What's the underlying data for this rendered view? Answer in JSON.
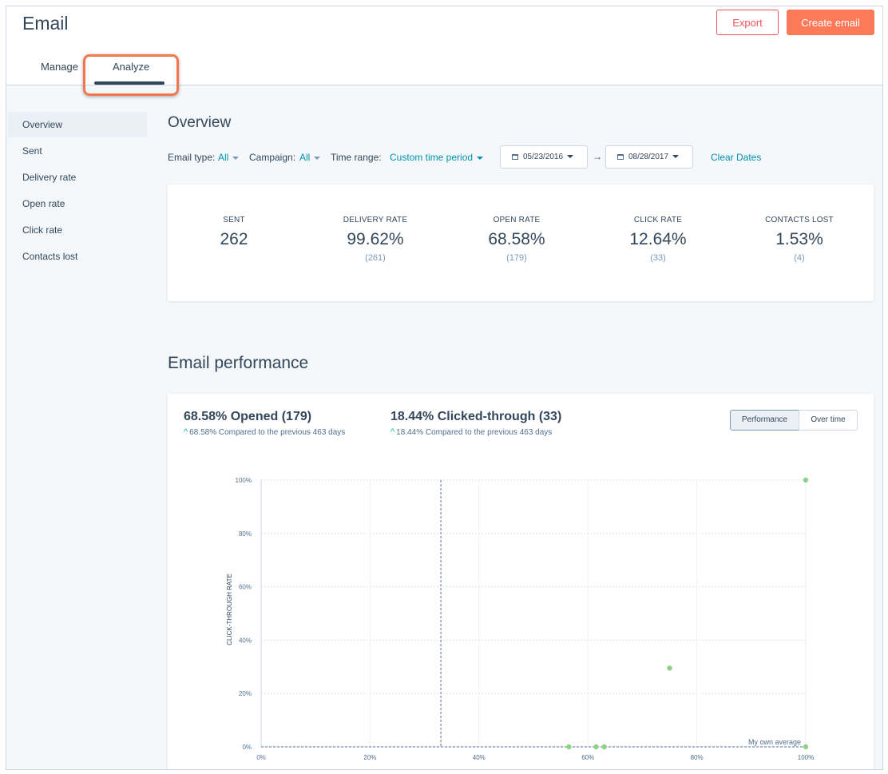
{
  "header": {
    "title": "Email",
    "export_label": "Export",
    "create_label": "Create email",
    "tabs": [
      {
        "label": "Manage"
      },
      {
        "label": "Analyze"
      }
    ]
  },
  "sidebar": {
    "items": [
      {
        "label": "Overview"
      },
      {
        "label": "Sent"
      },
      {
        "label": "Delivery rate"
      },
      {
        "label": "Open rate"
      },
      {
        "label": "Click rate"
      },
      {
        "label": "Contacts lost"
      }
    ]
  },
  "overview": {
    "title": "Overview",
    "filters": {
      "email_type_label": "Email type:",
      "email_type_value": "All",
      "campaign_label": "Campaign:",
      "campaign_value": "All",
      "time_range_label": "Time range:",
      "time_range_value": "Custom time period",
      "start_date": "05/23/2016",
      "end_date": "08/28/2017",
      "arrow": "→",
      "clear_label": "Clear Dates"
    },
    "stats": [
      {
        "label": "SENT",
        "value": "262",
        "sub": ""
      },
      {
        "label": "DELIVERY RATE",
        "value": "99.62%",
        "sub": "(261)"
      },
      {
        "label": "OPEN RATE",
        "value": "68.58%",
        "sub": "(179)"
      },
      {
        "label": "CLICK RATE",
        "value": "12.64%",
        "sub": "(33)"
      },
      {
        "label": "CONTACTS LOST",
        "value": "1.53%",
        "sub": "(4)"
      }
    ]
  },
  "performance": {
    "title": "Email performance",
    "opened_headline": "68.58% Opened (179)",
    "opened_compare": "68.58% Compared to the previous 463 days",
    "clicked_headline": "18.44% Clicked-through (33)",
    "clicked_compare": "18.44% Compared to the previous 463 days",
    "toggle_performance": "Performance",
    "toggle_over_time": "Over time",
    "up_arrow": "^"
  },
  "colors": {
    "accent": "#ff7a59",
    "teal_link": "#0091ae",
    "point": "#8fd08a",
    "text": "#33475b"
  },
  "chart_data": {
    "type": "scatter",
    "ylabel": "CLICK-THROUGH RATE",
    "xlabel": "",
    "x_ticks": [
      "0%",
      "20%",
      "40%",
      "60%",
      "80%",
      "100%"
    ],
    "y_ticks": [
      "0%",
      "20%",
      "40%",
      "60%",
      "80%",
      "100%"
    ],
    "xlim": [
      0,
      100
    ],
    "ylim": [
      0,
      100
    ],
    "reference_label": "My own average",
    "reference_x": 33,
    "reference_y": 0,
    "points": [
      {
        "x": 100,
        "y": 100
      },
      {
        "x": 75,
        "y": 29.5
      },
      {
        "x": 56.5,
        "y": 0
      },
      {
        "x": 61.5,
        "y": 0
      },
      {
        "x": 63,
        "y": 0
      },
      {
        "x": 100,
        "y": 0
      }
    ]
  }
}
